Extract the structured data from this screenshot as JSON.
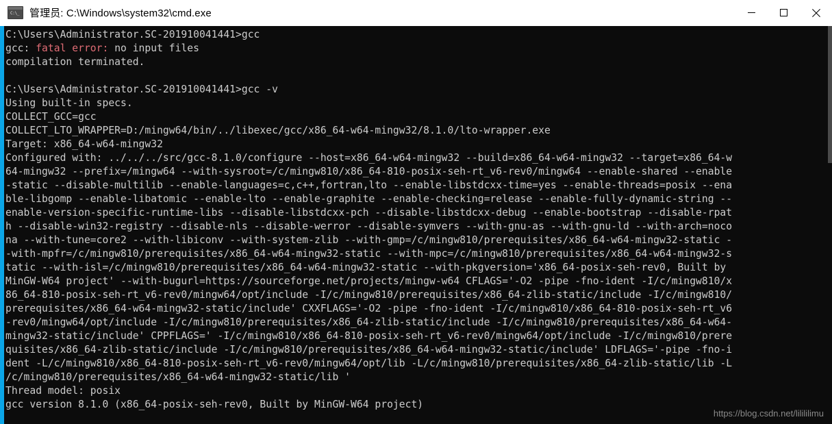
{
  "window": {
    "title": "管理员: C:\\Windows\\system32\\cmd.exe",
    "icon": "cmd-icon",
    "minimize_label": "最小化",
    "maximize_label": "最大化",
    "close_label": "关闭"
  },
  "colors": {
    "titlebar_bg": "#ffffff",
    "console_bg": "#0c0c0c",
    "console_fg": "#cccccc",
    "error_fg": "#e06c75",
    "accent": "#0ba6e8",
    "scrollbar_thumb": "#4a4a4a"
  },
  "terminal": {
    "lines": [
      {
        "id": "l01",
        "text": "C:\\Users\\Administrator.SC-201910041441>gcc"
      },
      {
        "id": "l02",
        "segments": [
          {
            "text": "gcc: ",
            "style": "normal"
          },
          {
            "text": "fatal error: ",
            "style": "error"
          },
          {
            "text": "no input files",
            "style": "normal"
          }
        ]
      },
      {
        "id": "l03",
        "text": "compilation terminated."
      },
      {
        "id": "l04",
        "text": ""
      },
      {
        "id": "l05",
        "text": "C:\\Users\\Administrator.SC-201910041441>gcc -v"
      },
      {
        "id": "l06",
        "text": "Using built-in specs."
      },
      {
        "id": "l07",
        "text": "COLLECT_GCC=gcc"
      },
      {
        "id": "l08",
        "text": "COLLECT_LTO_WRAPPER=D:/mingw64/bin/../libexec/gcc/x86_64-w64-mingw32/8.1.0/lto-wrapper.exe"
      },
      {
        "id": "l09",
        "text": "Target: x86_64-w64-mingw32"
      },
      {
        "id": "l10",
        "text": "Configured with: ../../../src/gcc-8.1.0/configure --host=x86_64-w64-mingw32 --build=x86_64-w64-mingw32 --target=x86_64-w"
      },
      {
        "id": "l11",
        "text": "64-mingw32 --prefix=/mingw64 --with-sysroot=/c/mingw810/x86_64-810-posix-seh-rt_v6-rev0/mingw64 --enable-shared --enable"
      },
      {
        "id": "l12",
        "text": "-static --disable-multilib --enable-languages=c,c++,fortran,lto --enable-libstdcxx-time=yes --enable-threads=posix --ena"
      },
      {
        "id": "l13",
        "text": "ble-libgomp --enable-libatomic --enable-lto --enable-graphite --enable-checking=release --enable-fully-dynamic-string --"
      },
      {
        "id": "l14",
        "text": "enable-version-specific-runtime-libs --disable-libstdcxx-pch --disable-libstdcxx-debug --enable-bootstrap --disable-rpat"
      },
      {
        "id": "l15",
        "text": "h --disable-win32-registry --disable-nls --disable-werror --disable-symvers --with-gnu-as --with-gnu-ld --with-arch=noco"
      },
      {
        "id": "l16",
        "text": "na --with-tune=core2 --with-libiconv --with-system-zlib --with-gmp=/c/mingw810/prerequisites/x86_64-w64-mingw32-static -"
      },
      {
        "id": "l17",
        "text": "-with-mpfr=/c/mingw810/prerequisites/x86_64-w64-mingw32-static --with-mpc=/c/mingw810/prerequisites/x86_64-w64-mingw32-s"
      },
      {
        "id": "l18",
        "text": "tatic --with-isl=/c/mingw810/prerequisites/x86_64-w64-mingw32-static --with-pkgversion='x86_64-posix-seh-rev0, Built by"
      },
      {
        "id": "l19",
        "text": "MinGW-W64 project' --with-bugurl=https://sourceforge.net/projects/mingw-w64 CFLAGS='-O2 -pipe -fno-ident -I/c/mingw810/x"
      },
      {
        "id": "l20",
        "text": "86_64-810-posix-seh-rt_v6-rev0/mingw64/opt/include -I/c/mingw810/prerequisites/x86_64-zlib-static/include -I/c/mingw810/"
      },
      {
        "id": "l21",
        "text": "prerequisites/x86_64-w64-mingw32-static/include' CXXFLAGS='-O2 -pipe -fno-ident -I/c/mingw810/x86_64-810-posix-seh-rt_v6"
      },
      {
        "id": "l22",
        "text": "-rev0/mingw64/opt/include -I/c/mingw810/prerequisites/x86_64-zlib-static/include -I/c/mingw810/prerequisites/x86_64-w64-"
      },
      {
        "id": "l23",
        "text": "mingw32-static/include' CPPFLAGS=' -I/c/mingw810/x86_64-810-posix-seh-rt_v6-rev0/mingw64/opt/include -I/c/mingw810/prere"
      },
      {
        "id": "l24",
        "text": "quisites/x86_64-zlib-static/include -I/c/mingw810/prerequisites/x86_64-w64-mingw32-static/include' LDFLAGS='-pipe -fno-i"
      },
      {
        "id": "l25",
        "text": "dent -L/c/mingw810/x86_64-810-posix-seh-rt_v6-rev0/mingw64/opt/lib -L/c/mingw810/prerequisites/x86_64-zlib-static/lib -L"
      },
      {
        "id": "l26",
        "text": "/c/mingw810/prerequisites/x86_64-w64-mingw32-static/lib '"
      },
      {
        "id": "l27",
        "text": "Thread model: posix"
      },
      {
        "id": "l28",
        "text": "gcc version 8.1.0 (x86_64-posix-seh-rev0, Built by MinGW-W64 project)"
      }
    ]
  },
  "watermark": {
    "text": "https://blog.csdn.net/lilililimu"
  }
}
